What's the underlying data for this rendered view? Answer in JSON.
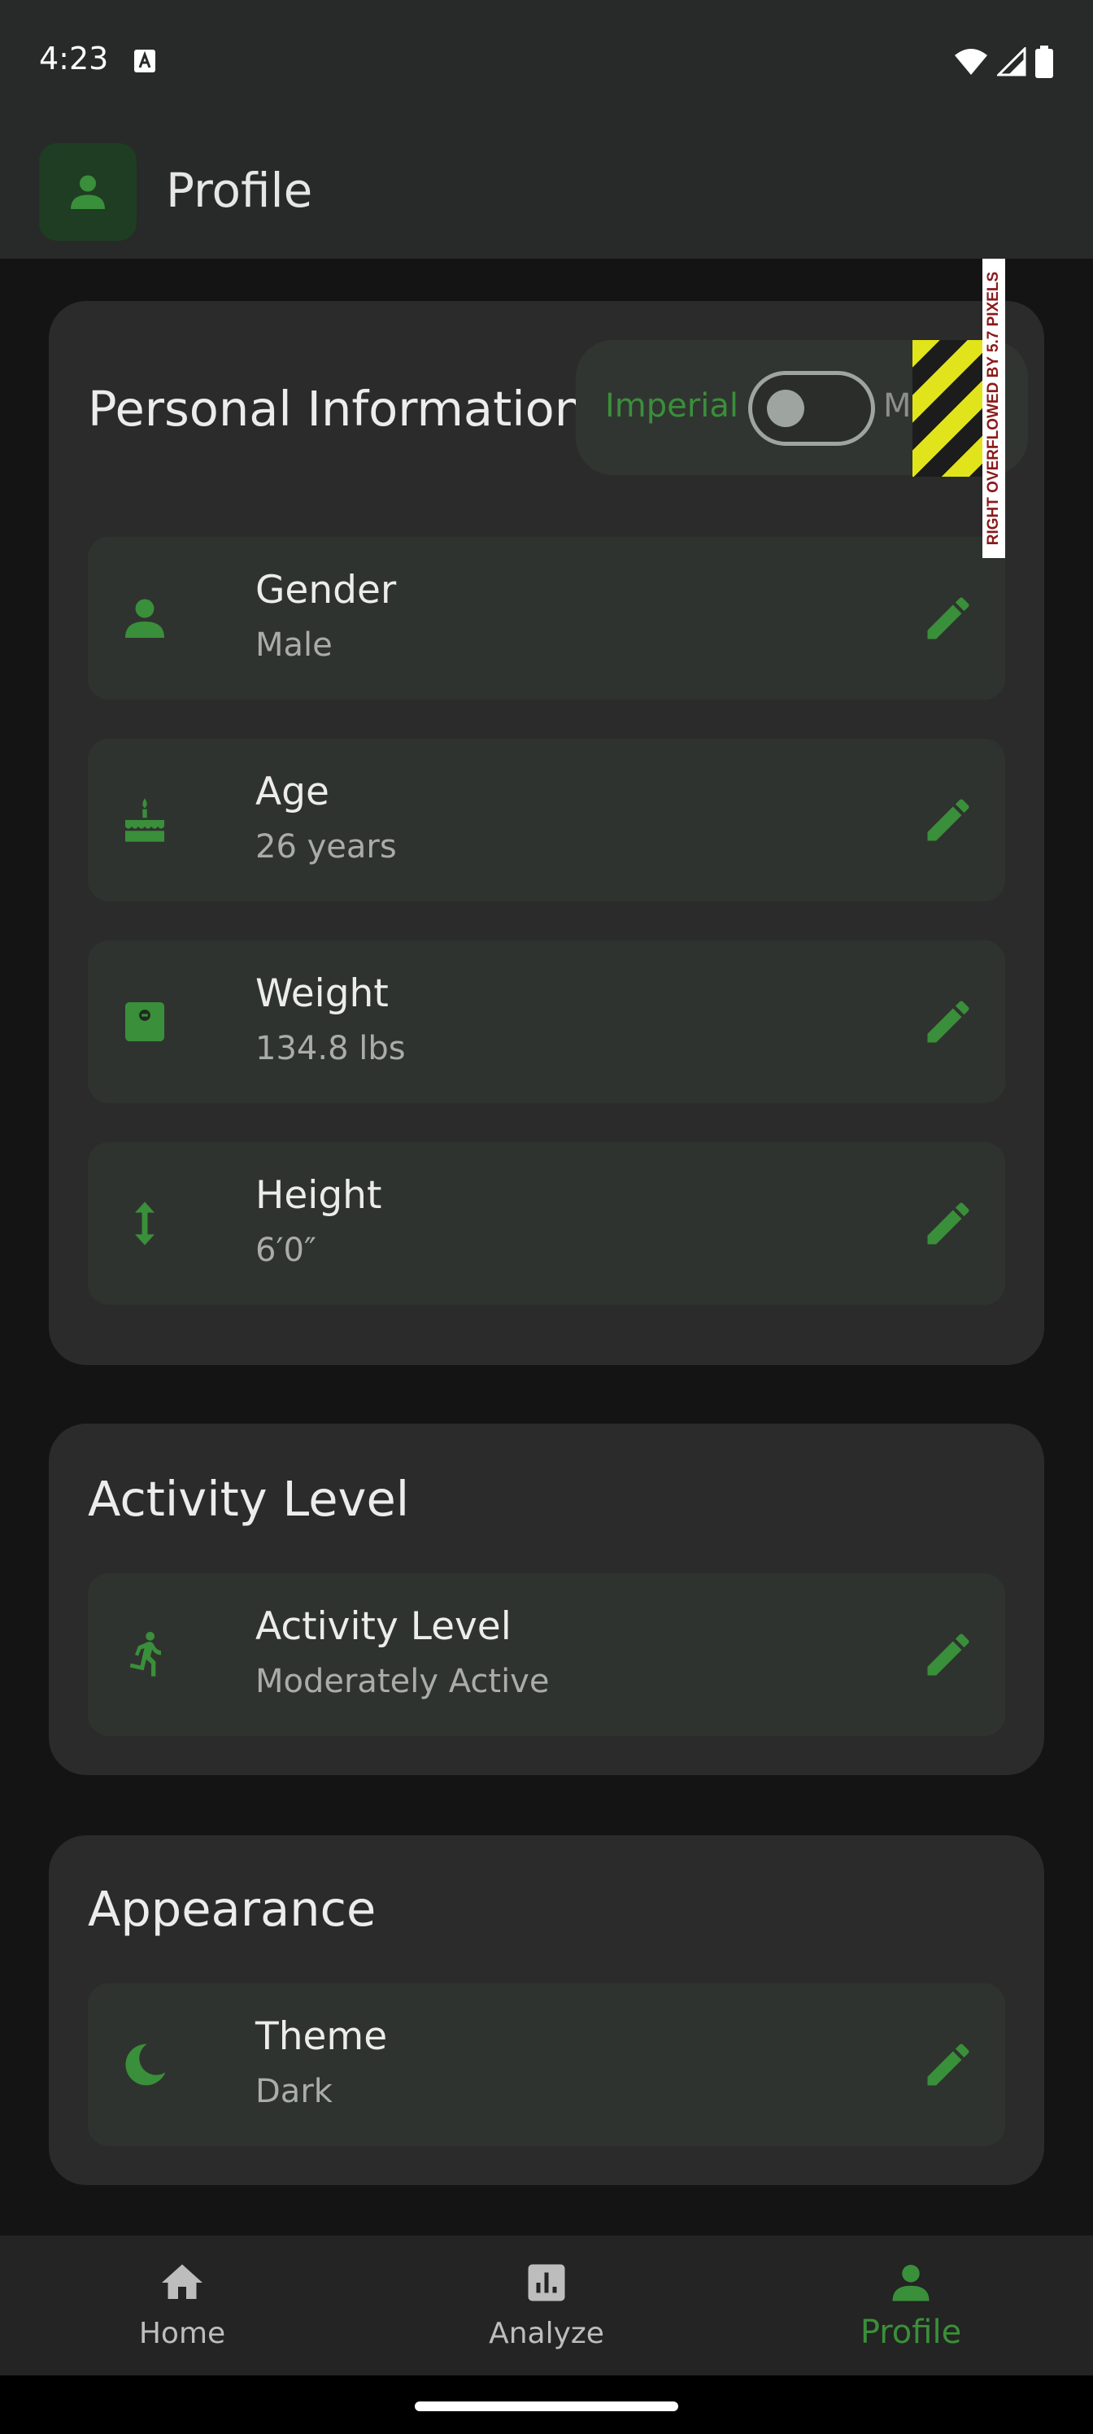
{
  "status_bar": {
    "time": "4:23"
  },
  "app_bar": {
    "title": "Profile"
  },
  "personal_info": {
    "title": "Personal Information",
    "unit_toggle": {
      "left_label": "Imperial",
      "right_label": "Metric",
      "state": "off"
    },
    "overflow_warning": "RIGHT OVERFLOWED BY 5.7 PIXELS",
    "items": [
      {
        "title": "Gender",
        "value": "Male",
        "icon": "person-icon"
      },
      {
        "title": "Age",
        "value": "26 years",
        "icon": "cake-icon"
      },
      {
        "title": "Weight",
        "value": "134.8 lbs",
        "icon": "scale-icon"
      },
      {
        "title": "Height",
        "value": "6′0″",
        "icon": "height-icon"
      }
    ]
  },
  "activity": {
    "title": "Activity Level",
    "items": [
      {
        "title": "Activity Level",
        "value": "Moderately Active",
        "icon": "running-icon"
      }
    ]
  },
  "appearance": {
    "title": "Appearance",
    "items": [
      {
        "title": "Theme",
        "value": "Dark",
        "icon": "moon-icon"
      }
    ]
  },
  "bottom_nav": {
    "items": [
      {
        "label": "Home",
        "icon": "home-icon",
        "active": false
      },
      {
        "label": "Analyze",
        "icon": "chart-icon",
        "active": false
      },
      {
        "label": "Profile",
        "icon": "person-icon",
        "active": true
      }
    ]
  },
  "colors": {
    "accent": "#3a8f3a",
    "background": "#141414",
    "card": "#2b2b2b",
    "item": "#2f332f"
  }
}
